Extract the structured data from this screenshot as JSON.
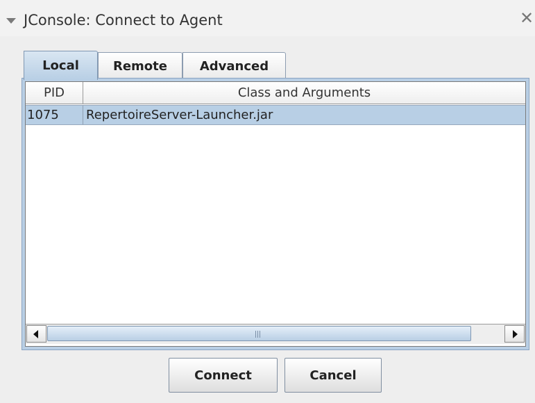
{
  "window": {
    "title": "JConsole: Connect to Agent"
  },
  "tabs": [
    {
      "label": "Local",
      "selected": true
    },
    {
      "label": "Remote",
      "selected": false
    },
    {
      "label": "Advanced",
      "selected": false
    }
  ],
  "table": {
    "columns": [
      "PID",
      "Class and Arguments"
    ],
    "rows": [
      {
        "pid": "1075",
        "class_and_arguments": "RepertoireServer-Launcher.jar",
        "selected": true
      }
    ]
  },
  "buttons": {
    "connect": "Connect",
    "cancel": "Cancel"
  },
  "colors": {
    "selection": "#b8cfe5",
    "tab_selected": "#c5d8ec"
  }
}
